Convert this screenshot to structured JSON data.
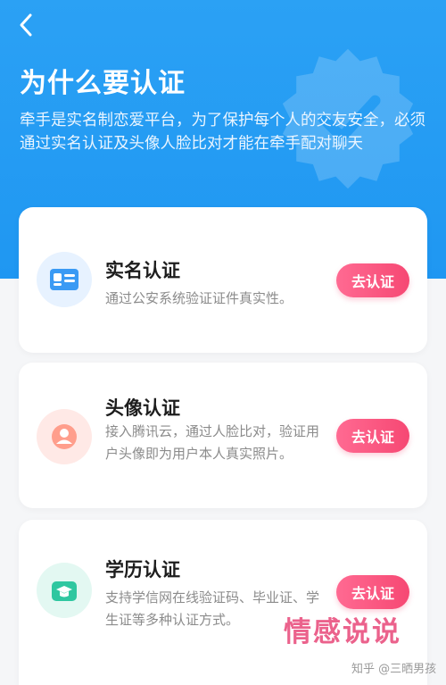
{
  "header": {
    "back_icon": "chevron-left-icon",
    "title": "为什么要认证",
    "description": "牵手是实名制恋爱平台，为了保护每个人的交友安全，必须通过实名认证及头像人脸比对才能在牵手配对聊天"
  },
  "cards": [
    {
      "icon": "id-card-icon",
      "icon_bg": "#e7f2ff",
      "icon_color": "#3a9af4",
      "title": "实名认证",
      "description": "通过公安系统验证证件真实性。",
      "button": "去认证"
    },
    {
      "icon": "user-icon",
      "icon_bg": "#ffe9e6",
      "icon_color": "#ff8a78",
      "title": "头像认证",
      "description": "接入腾讯云，通过人脸比对，验证用户头像即为用户本人真实照片。",
      "button": "去认证"
    },
    {
      "icon": "graduation-cap-icon",
      "icon_bg": "#e3f8f2",
      "icon_color": "#2fc7a0",
      "title": "学历认证",
      "description": "支持学信网在线验证码、毕业证、学生证等多种认证方式。",
      "button": "去认证"
    }
  ],
  "watermark": {
    "brand": "情感说说",
    "source": "知乎 @三晒男孩"
  },
  "colors": {
    "primary_blue": "#2ba1f4",
    "button_pink": "#f64873",
    "page_bg": "#f5f6f8"
  }
}
